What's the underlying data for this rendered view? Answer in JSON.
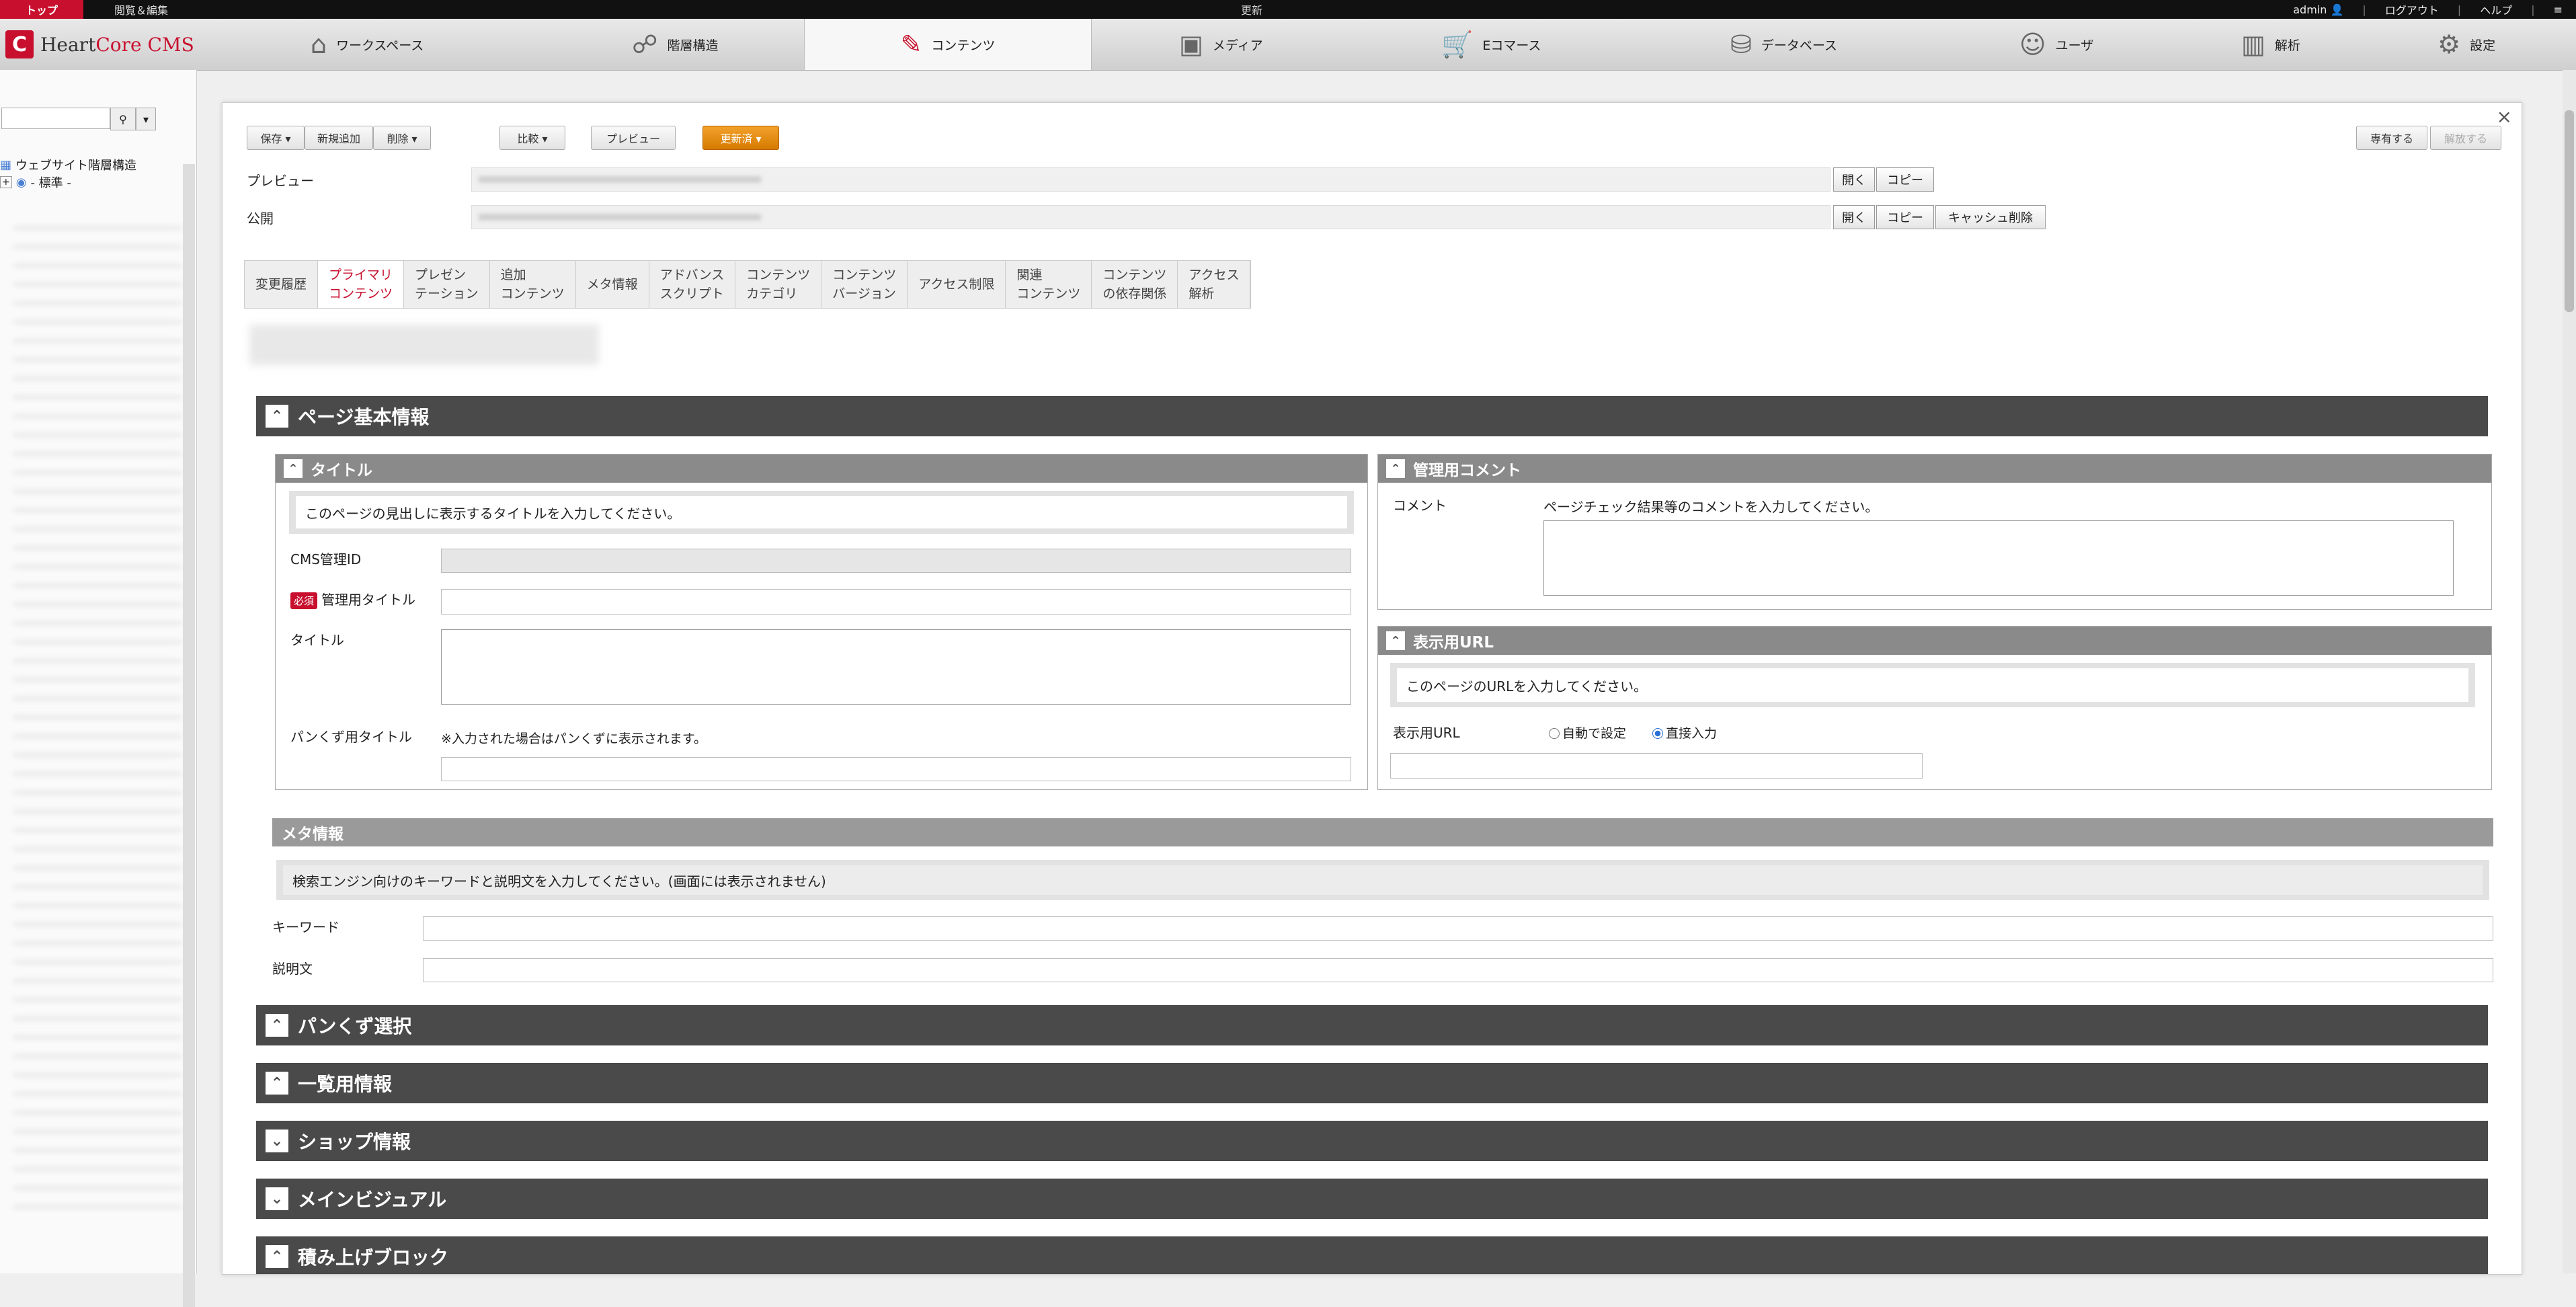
{
  "topbar": {
    "top": "トップ",
    "browse_edit": "閲覧＆編集",
    "center": "更新",
    "admin": "admin",
    "logout": "ログアウト",
    "help": "ヘルプ",
    "menu_icon": "≡"
  },
  "logo": {
    "mark": "C",
    "name_a": "Heart",
    "name_b": "Core",
    "name_c": " CMS"
  },
  "nav": [
    {
      "label": "ワークスペース",
      "icon": "workspace-icon",
      "glyph": "⌂"
    },
    {
      "label": "階層構造",
      "icon": "hierarchy-icon",
      "glyph": "☍"
    },
    {
      "label": "コンテンツ",
      "icon": "content-icon",
      "glyph": "✎"
    },
    {
      "label": "メディア",
      "icon": "media-icon",
      "glyph": "▣"
    },
    {
      "label": "Eコマース",
      "icon": "cart-icon",
      "glyph": "🛒"
    },
    {
      "label": "データベース",
      "icon": "database-icon",
      "glyph": "⛁"
    },
    {
      "label": "ユーザ",
      "icon": "user-icon",
      "glyph": "☺"
    },
    {
      "label": "解析",
      "icon": "chart-icon",
      "glyph": "▥"
    },
    {
      "label": "設定",
      "icon": "gear-icon",
      "glyph": "⚙"
    }
  ],
  "sidebar": {
    "search_icon": "⚲",
    "dropdown": "▾",
    "tree_root": "ウェブサイト階層構造",
    "tree_child": "- 標準 -"
  },
  "toolbar": {
    "save": "保存 ▾",
    "new": "新規追加",
    "delete": "削除 ▾",
    "compare": "比較 ▾",
    "preview": "プレビュー",
    "updated": "更新済 ▾",
    "own": "専有する",
    "release": "解放する"
  },
  "urls": {
    "preview_label": "プレビュー",
    "public_label": "公開",
    "open": "開く",
    "copy": "コピー",
    "cache_delete": "キャッシュ削除"
  },
  "tabs": [
    "変更履歴",
    "プライマリ\nコンテンツ",
    "プレゼン\nテーション",
    "追加\nコンテンツ",
    "メタ情報",
    "アドバンス\nスクリプト",
    "コンテンツ\nカテゴリ",
    "コンテンツ\nバージョン",
    "アクセス制限",
    "関連\nコンテンツ",
    "コンテンツ\nの依存関係",
    "アクセス\n解析"
  ],
  "sections": {
    "basic": "ページ基本情報",
    "breadcrumb_sel": "パンくず選択",
    "list_info": "一覧用情報",
    "shop_info": "ショップ情報",
    "main_visual": "メインビジュアル",
    "stack_block": "積み上げブロック"
  },
  "title_panel": {
    "header": "タイトル",
    "hint": "このページの見出しに表示するタイトルを入力してください。",
    "cms_id": "CMS管理ID",
    "required": "必須",
    "admin_title": "管理用タイトル",
    "title": "タイトル",
    "breadcrumb_title": "パンくず用タイトル",
    "breadcrumb_note": "※入力された場合はパンくずに表示されます。"
  },
  "comment_panel": {
    "header": "管理用コメント",
    "label": "コメント",
    "hint": "ページチェック結果等のコメントを入力してください。"
  },
  "url_panel": {
    "header": "表示用URL",
    "hint": "このページのURLを入力してください。",
    "label": "表示用URL",
    "auto": "自動で設定",
    "direct": "直接入力"
  },
  "meta_panel": {
    "header": "メタ情報",
    "hint": "検索エンジン向けのキーワードと説明文を入力してください。(画面には表示されません)",
    "keyword": "キーワード",
    "description": "説明文"
  },
  "icons": {
    "collapse": "⌃",
    "expand": "⌄",
    "close": "×"
  },
  "colors": {
    "brand": "#c8102e",
    "orange": "#e08a00",
    "section": "#4a4a4a"
  }
}
